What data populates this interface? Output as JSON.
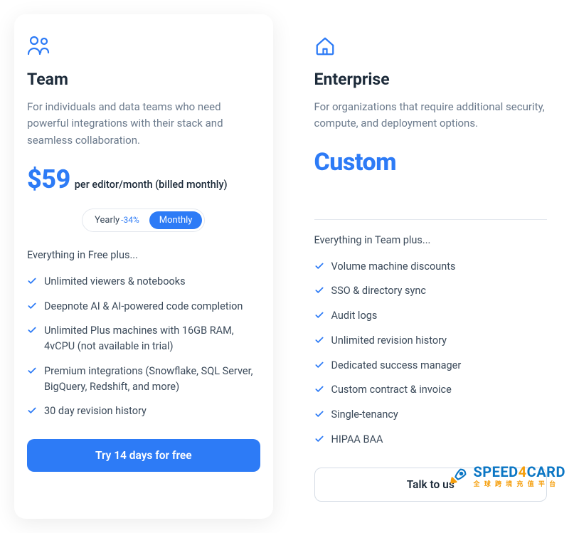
{
  "plans": {
    "team": {
      "title": "Team",
      "description": "For individuals and data teams who need powerful integrations with their stack and seamless collaboration.",
      "price": "$59",
      "price_sub": "per editor/month (billed monthly)",
      "billing_toggle": {
        "yearly_label": "Yearly",
        "yearly_discount": "-34%",
        "monthly_label": "Monthly",
        "active": "monthly"
      },
      "plus_label": "Everything in Free plus...",
      "features": [
        "Unlimited viewers & notebooks",
        "Deepnote AI & AI-powered code completion",
        "Unlimited Plus machines with 16GB RAM, 4vCPU (not available in trial)",
        "Premium integrations (Snowflake, SQL Server, BigQuery, Redshift, and more)",
        "30 day revision history"
      ],
      "cta": "Try 14 days for free"
    },
    "enterprise": {
      "title": "Enterprise",
      "description": "For organizations that require additional security, compute, and deployment options.",
      "price_label": "Custom",
      "plus_label": "Everything in Team plus...",
      "features": [
        "Volume machine discounts",
        "SSO & directory sync",
        "Audit logs",
        "Unlimited revision history",
        "Dedicated success manager",
        "Custom contract & invoice",
        "Single-tenancy",
        "HIPAA BAA"
      ],
      "cta": "Talk to us"
    }
  },
  "watermark": {
    "brand_a": "SPEED",
    "brand_b": "4",
    "brand_c": "CARD",
    "sub": "全 球 跨 境 充 值 平 台"
  }
}
